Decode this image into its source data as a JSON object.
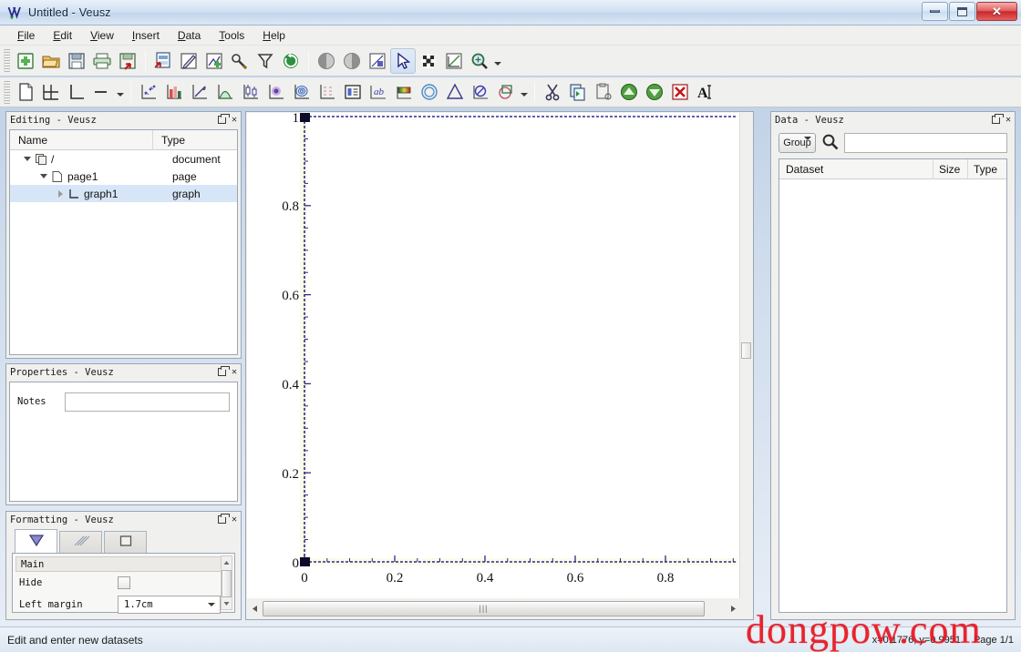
{
  "window": {
    "title": "Untitled - Veusz",
    "app_icon": "veusz-logo-icon",
    "minimize_label": "",
    "maximize_label": "",
    "close_label": "✕"
  },
  "menubar": {
    "items": [
      {
        "label": "File",
        "mnemonic": "F"
      },
      {
        "label": "Edit",
        "mnemonic": "E"
      },
      {
        "label": "View",
        "mnemonic": "V"
      },
      {
        "label": "Insert",
        "mnemonic": "I"
      },
      {
        "label": "Data",
        "mnemonic": "D"
      },
      {
        "label": "Tools",
        "mnemonic": "T"
      },
      {
        "label": "Help",
        "mnemonic": "H"
      }
    ]
  },
  "toolbar_main": {
    "groups": [
      [
        "new-document-icon",
        "open-document-icon",
        "save-document-icon",
        "print-icon",
        "export-icon"
      ],
      [
        "import-data-icon",
        "edit-data-icon",
        "create-dataset-icon",
        "capture-data-icon",
        "filter-data-icon",
        "reload-data-icon"
      ],
      [
        "prev-page-icon",
        "next-page-icon",
        "zoom-fit-icon",
        "select-pointer-icon",
        "zoom-grid-icon",
        "zoom-graph-icon",
        "zoom-magnifier-icon"
      ]
    ],
    "zoom_has_dropdown": true
  },
  "toolbar_insert": {
    "groups": [
      [
        "add-page-icon",
        "add-graph-icon",
        "add-axis-icon",
        "add-line-icon"
      ],
      [
        "add-xy-plot-icon",
        "add-bar-icon",
        "add-function-icon",
        "add-fit-icon",
        "add-boxplot-icon",
        "add-image-icon",
        "add-contour-icon",
        "add-vectorfield-icon",
        "add-key-icon",
        "add-label-icon",
        "add-colorbar-icon",
        "add-ellipse-icon",
        "add-polygon-icon",
        "add-imagefile-icon",
        "add-shape-icon"
      ],
      [
        "cut-icon",
        "copy-icon",
        "paste-icon",
        "move-up-icon",
        "move-down-icon",
        "delete-icon",
        "rename-icon"
      ]
    ]
  },
  "editing_panel": {
    "title": "Editing - Veusz",
    "columns": [
      "Name",
      "Type"
    ],
    "rows": [
      {
        "label": "/",
        "type": "document",
        "indent": 0,
        "expander": "down",
        "icon": "document-icon",
        "selected": false
      },
      {
        "label": "page1",
        "type": "page",
        "indent": 1,
        "expander": "down",
        "icon": "page-icon",
        "selected": false
      },
      {
        "label": "graph1",
        "type": "graph",
        "indent": 2,
        "expander": "right",
        "icon": "graph-icon",
        "selected": true
      }
    ],
    "float_label": "restore",
    "close_label": "✕"
  },
  "properties_panel": {
    "title": "Properties - Veusz",
    "notes_label": "Notes",
    "notes_value": "",
    "notes_placeholder": ""
  },
  "formatting_panel": {
    "title": "Formatting - Veusz",
    "tabs": [
      {
        "name": "main-tab",
        "icon": "triangle-icon",
        "active": true
      },
      {
        "name": "background-tab",
        "icon": "hatch-icon",
        "active": false
      },
      {
        "name": "border-tab",
        "icon": "square-icon",
        "active": false
      }
    ],
    "section": "Main",
    "rows": [
      {
        "label": "Hide",
        "control": "checkbox",
        "value": ""
      },
      {
        "label": "Left margin",
        "control": "combo",
        "value": "1.7cm"
      }
    ]
  },
  "data_panel": {
    "title": "Data - Veusz",
    "group_label": "Group",
    "search_value": "",
    "search_placeholder": "",
    "search_icon": "search-icon",
    "columns": [
      "Dataset",
      "Size",
      "Type"
    ],
    "rows": []
  },
  "statusbar": {
    "message": "Edit and enter new datasets",
    "coords": "x=0.1776, y=0.9951",
    "page": "Page 1/1"
  },
  "watermark": {
    "text": "dongpow.com",
    "color": "#e6141e"
  },
  "chart_data": {
    "type": "scatter",
    "title": "",
    "xlabel": "",
    "ylabel": "",
    "x": [],
    "y": [],
    "xlim": [
      0,
      1
    ],
    "ylim": [
      0,
      1
    ],
    "xticks": [
      "0",
      "0.2",
      "0.4",
      "0.6",
      "0.8"
    ],
    "xtick_values": [
      0,
      0.2,
      0.4,
      0.6,
      0.8
    ],
    "yticks": [
      "0",
      "0.2",
      "0.4",
      "0.6",
      "0.8",
      "1"
    ],
    "ytick_values": [
      0,
      0.2,
      0.4,
      0.6,
      0.8,
      1
    ],
    "grid": false,
    "legend": false,
    "axis_color": "#2b2b8f",
    "selected": true,
    "selection_handles": [
      "top-left",
      "bottom-left"
    ]
  }
}
